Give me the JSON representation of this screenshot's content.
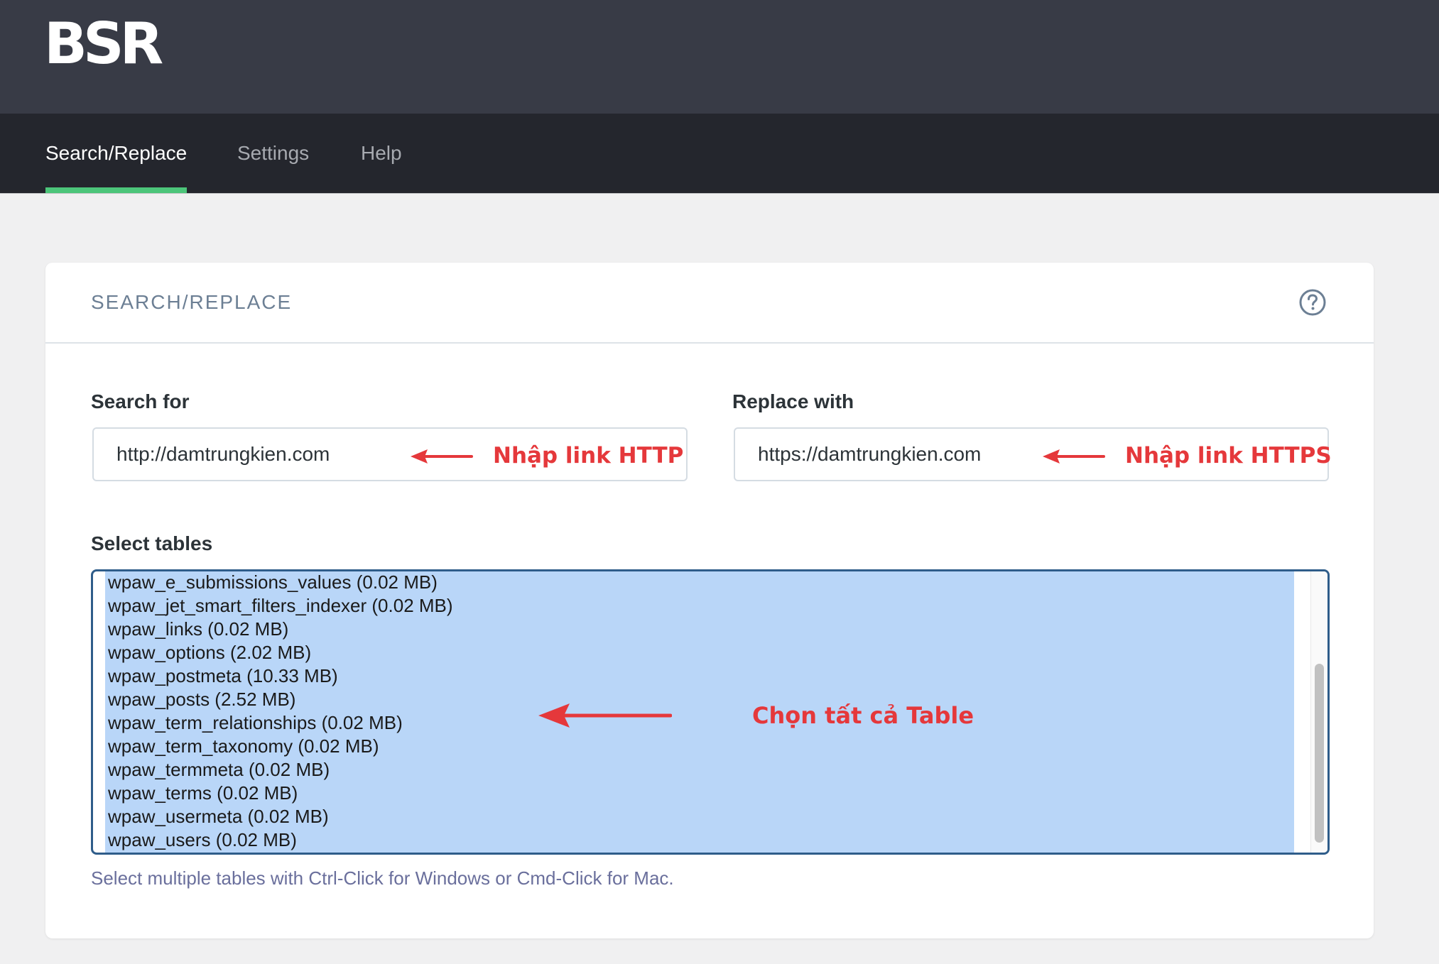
{
  "app": {
    "logo_text": "BSR"
  },
  "nav": {
    "tabs": [
      {
        "label": "Search/Replace",
        "active": true
      },
      {
        "label": "Settings",
        "active": false
      },
      {
        "label": "Help",
        "active": false
      }
    ]
  },
  "panel": {
    "title": "SEARCH/REPLACE",
    "help_icon": "question-circle-icon"
  },
  "search": {
    "label": "Search for",
    "value": "http://damtrungkien.com",
    "annotation": "Nhập link HTTP"
  },
  "replace": {
    "label": "Replace with",
    "value": "https://damtrungkien.com",
    "annotation": "Nhập link HTTPS"
  },
  "tables": {
    "label": "Select tables",
    "items": [
      "wpaw_e_submissions_values (0.02 MB)",
      "wpaw_jet_smart_filters_indexer (0.02 MB)",
      "wpaw_links (0.02 MB)",
      "wpaw_options (2.02 MB)",
      "wpaw_postmeta (10.33 MB)",
      "wpaw_posts (2.52 MB)",
      "wpaw_term_relationships (0.02 MB)",
      "wpaw_term_taxonomy (0.02 MB)",
      "wpaw_termmeta (0.02 MB)",
      "wpaw_terms (0.02 MB)",
      "wpaw_usermeta (0.02 MB)",
      "wpaw_users (0.02 MB)"
    ],
    "annotation": "Chọn tất cả Table",
    "hint": "Select multiple tables with Ctrl-Click for Windows or Cmd-Click for Mac."
  },
  "colors": {
    "accent": "#4cc57a",
    "annotation": "#e5383b",
    "selection": "#b9d6f8",
    "header_bg": "#383b46",
    "nav_bg": "#24262d"
  }
}
